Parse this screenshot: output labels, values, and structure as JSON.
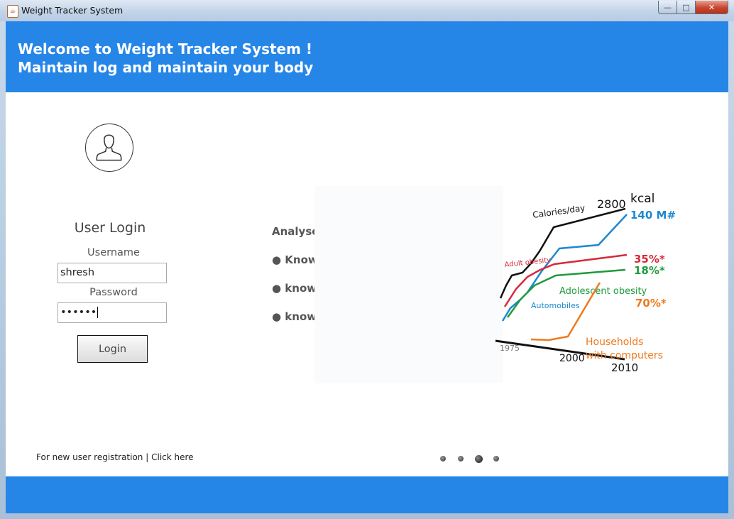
{
  "window": {
    "title": "Weight Tracker System",
    "app_icon": "java-cup-icon",
    "controls": {
      "minimize": "—",
      "maximize": "□",
      "close": "✕"
    }
  },
  "header": {
    "line1": "Welcome to Weight Tracker System !",
    "line2": "Maintain log and maintain your body",
    "color": "#2686e8"
  },
  "login": {
    "title": "User Login",
    "username_label": "Username",
    "username_value": "shresh",
    "password_label": "Password",
    "password_value": "••••••",
    "button": "Login"
  },
  "registration": {
    "text": "For new user registration",
    "separator": "|",
    "link": "Click here"
  },
  "features": {
    "heading": "Analyse calorie vs workout",
    "items": [
      "● Know how much you ate",
      "● know how much callorie is used",
      "● know your callorie-weight trend"
    ]
  },
  "illustration": {
    "labels": {
      "calories": "Calories/day",
      "kcal_value": "2800",
      "kcal_unit": "kcal",
      "automobiles_count": "140 M#",
      "adult_obesity": "Adult obesity",
      "adult_pct": "35%*",
      "adolescent_pct": "18%*",
      "adolescent": "Adolescent obesity",
      "automobiles": "Automobiles",
      "households_pct": "70%*",
      "households1": "Households",
      "households2": "with computers",
      "year1": "1975",
      "year2": "2000",
      "year3": "2010"
    }
  },
  "carousel": {
    "count": 4,
    "active_index": 2
  }
}
